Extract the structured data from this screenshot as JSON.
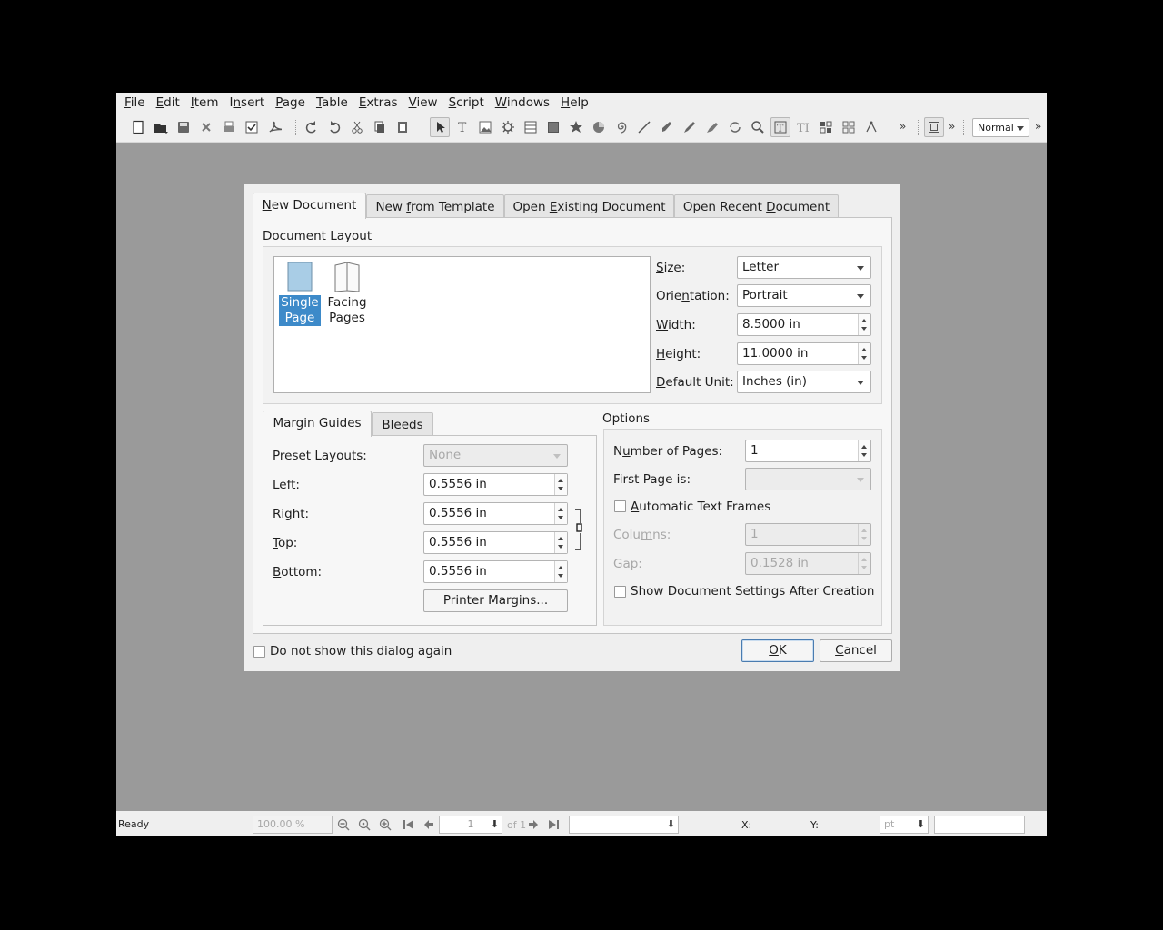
{
  "menubar": {
    "items": [
      {
        "label": "File",
        "mnemonic": "F",
        "rest": "ile"
      },
      {
        "label": "Edit",
        "mnemonic": "E",
        "rest": "dit"
      },
      {
        "label": "Item",
        "mnemonic": "I",
        "rest": "tem"
      },
      {
        "label": "Insert",
        "pre": "I",
        "mnemonic": "n",
        "rest": "sert"
      },
      {
        "label": "Page",
        "mnemonic": "P",
        "rest": "age"
      },
      {
        "label": "Table",
        "mnemonic": "T",
        "rest": "able"
      },
      {
        "label": "Extras",
        "mnemonic": "E",
        "rest": "xtras"
      },
      {
        "label": "View",
        "mnemonic": "V",
        "rest": "iew"
      },
      {
        "label": "Script",
        "mnemonic": "S",
        "rest": "cript"
      },
      {
        "label": "Windows",
        "mnemonic": "W",
        "rest": "indows"
      },
      {
        "label": "Help",
        "mnemonic": "H",
        "rest": "elp"
      }
    ]
  },
  "toolbar": {
    "view_mode": "Normal",
    "overflow_glyph": "»"
  },
  "dialog": {
    "tabs": [
      {
        "label": "New Document",
        "pre": "",
        "mnemonic": "N",
        "rest": "ew Document"
      },
      {
        "label": "New from Template",
        "pre": "New ",
        "mnemonic": "f",
        "rest": "rom Template"
      },
      {
        "label": "Open Existing Document",
        "pre": "Open ",
        "mnemonic": "E",
        "rest": "xisting Document"
      },
      {
        "label": "Open Recent Document",
        "pre": "Open Recent ",
        "mnemonic": "D",
        "rest": "ocument"
      }
    ],
    "document_layout": {
      "title": "Document Layout",
      "layouts": [
        {
          "line1": "Single",
          "line2": "Page",
          "selected": true
        },
        {
          "line1": "Facing",
          "line2": "Pages",
          "selected": false
        }
      ],
      "size": {
        "pre": "",
        "mnemonic": "S",
        "rest": "ize:",
        "value": "Letter"
      },
      "orientation": {
        "pre": "Orie",
        "mnemonic": "n",
        "rest": "tation:",
        "value": "Portrait"
      },
      "width": {
        "pre": "",
        "mnemonic": "W",
        "rest": "idth:",
        "value": "8.5000 in"
      },
      "height": {
        "pre": "",
        "mnemonic": "H",
        "rest": "eight:",
        "value": "11.0000 in"
      },
      "default_unit": {
        "pre": "",
        "mnemonic": "D",
        "rest": "efault Unit:",
        "value": "Inches (in)"
      }
    },
    "margins": {
      "tabs": [
        "Margin Guides",
        "Bleeds"
      ],
      "preset_label": "Preset Layouts:",
      "preset_value": "None",
      "left": {
        "mnemonic": "L",
        "rest": "eft:",
        "value": "0.5556 in"
      },
      "right": {
        "mnemonic": "R",
        "rest": "ight:",
        "value": "0.5556 in"
      },
      "top": {
        "mnemonic": "T",
        "rest": "op:",
        "value": "0.5556 in"
      },
      "bottom": {
        "mnemonic": "B",
        "rest": "ottom:",
        "value": "0.5556 in"
      },
      "printer_margins_button": "Printer Margins..."
    },
    "options": {
      "title": "Options",
      "num_pages": {
        "pre": "N",
        "mnemonic": "u",
        "rest": "mber of Pages:",
        "value": "1"
      },
      "first_page_label": "First Page is:",
      "first_page_value": "",
      "auto_text_frames": {
        "mnemonic": "A",
        "rest": "utomatic Text Frames",
        "checked": false
      },
      "columns": {
        "pre": "Colu",
        "mnemonic": "m",
        "rest": "ns:",
        "value": "1"
      },
      "gap": {
        "mnemonic": "G",
        "rest": "ap:",
        "value": "0.1528 in"
      },
      "show_settings": {
        "label": "Show Document Settings After Creation",
        "checked": false
      }
    },
    "footer": {
      "dont_show": {
        "label": "Do not show this dialog again",
        "checked": false
      },
      "ok": {
        "mnemonic": "O",
        "rest": "K"
      },
      "cancel": {
        "mnemonic": "C",
        "rest": "ancel"
      }
    }
  },
  "statusbar": {
    "status": "Ready",
    "zoom": "100.00 %",
    "page": "1",
    "of_pages": "of 1",
    "layer": "",
    "x_label": "X:",
    "y_label": "Y:",
    "unit": "pt"
  }
}
